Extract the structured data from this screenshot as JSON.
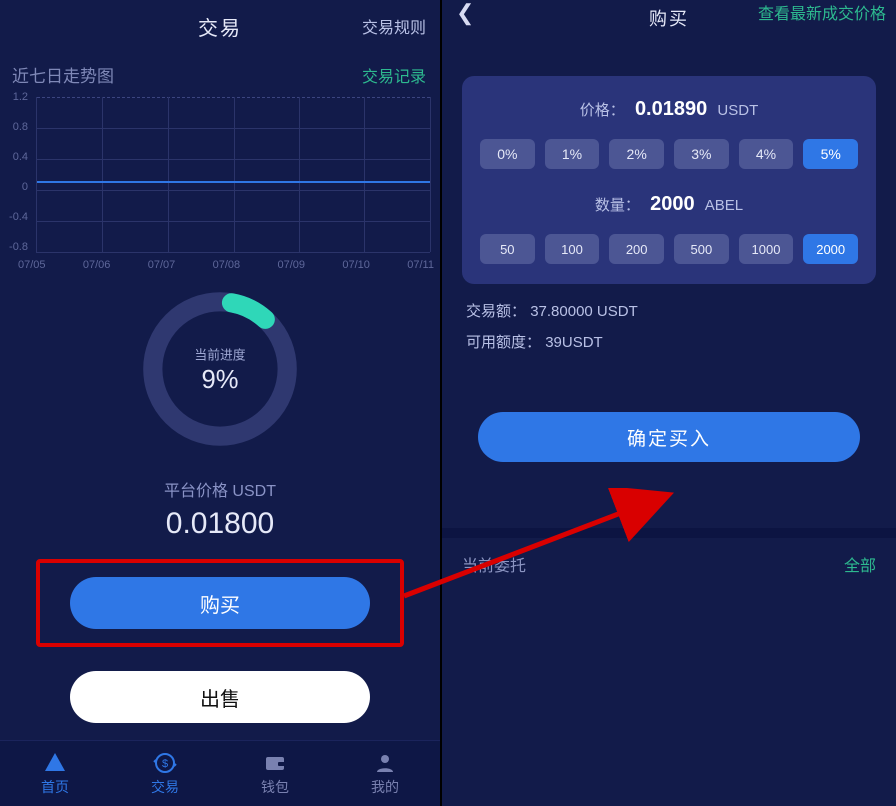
{
  "left": {
    "header_title": "交易",
    "header_rules": "交易规则",
    "trend_label": "近七日走势图",
    "trade_record": "交易记录",
    "progress_label": "当前进度",
    "progress_pct": "9%",
    "price_label": "平台价格 USDT",
    "price_value": "0.01800",
    "buy_label": "购买",
    "sell_label": "出售",
    "tabs": {
      "home": "首页",
      "trade": "交易",
      "wallet": "钱包",
      "mine": "我的"
    }
  },
  "right": {
    "title": "购买",
    "latest_price": "查看最新成交价格",
    "price_label": "价格：",
    "price_value": "0.01890",
    "price_unit": "USDT",
    "pct_options": [
      "0%",
      "1%",
      "2%",
      "3%",
      "4%",
      "5%"
    ],
    "pct_selected": "5%",
    "qty_label": "数量：",
    "qty_value": "2000",
    "qty_unit": "ABEL",
    "qty_options": [
      "50",
      "100",
      "200",
      "500",
      "1000",
      "2000"
    ],
    "qty_selected": "2000",
    "amount_label": "交易额：",
    "amount_value": "37.80000 USDT",
    "avail_label": "可用额度：",
    "avail_value": "39USDT",
    "confirm": "确定买入",
    "orders_label": "当前委托",
    "orders_all": "全部"
  },
  "chart_data": {
    "type": "line",
    "title": "近七日走势图",
    "ylabel": "",
    "xlabel": "",
    "y_ticks": [
      1.2,
      0.8,
      0.4,
      0.0,
      -0.4,
      -0.8
    ],
    "ylim": [
      -1.0,
      1.2
    ],
    "categories": [
      "07/05",
      "07/06",
      "07/07",
      "07/08",
      "07/09",
      "07/10",
      "07/11"
    ],
    "series": [
      {
        "name": "price",
        "values": [
          0,
          0,
          0,
          0,
          0,
          0,
          0
        ]
      }
    ]
  },
  "chart_progress": {
    "type": "donut",
    "percent": 9,
    "color_fg": "#2fd7b8",
    "color_bg": "#2f3870"
  }
}
